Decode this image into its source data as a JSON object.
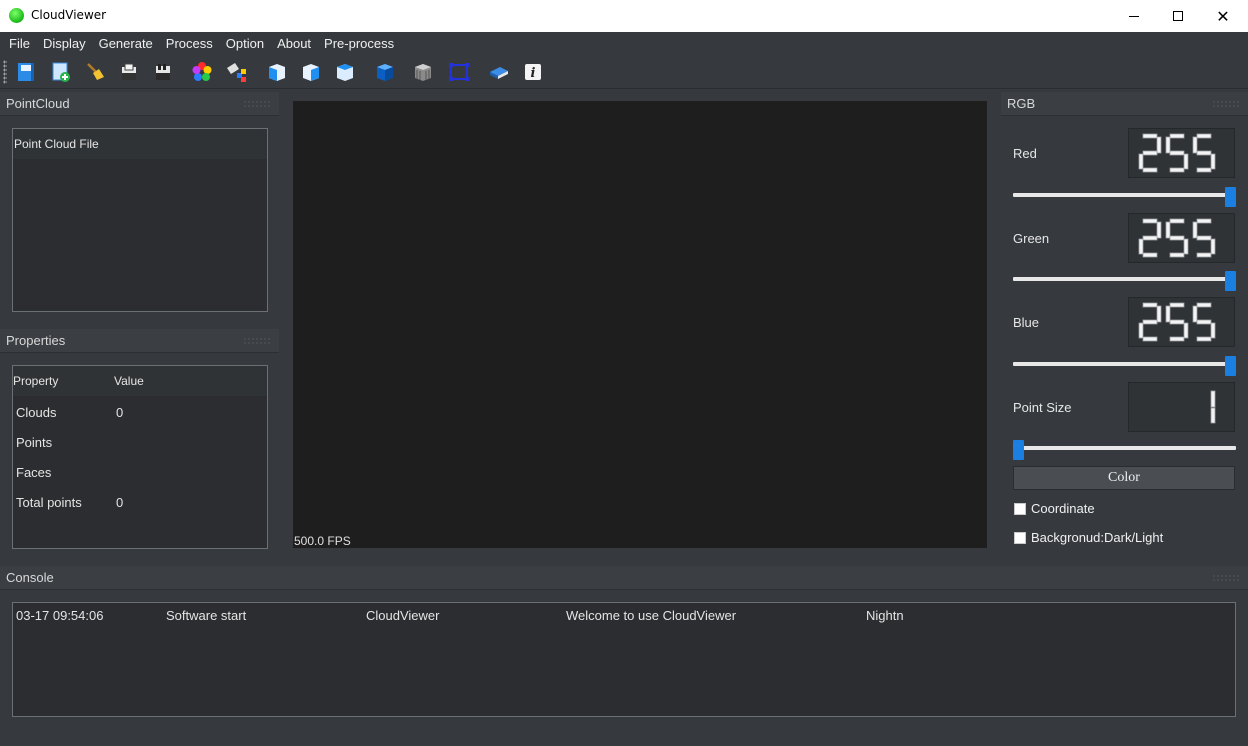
{
  "window": {
    "title": "CloudViewer"
  },
  "menu": [
    "File",
    "Display",
    "Generate",
    "Process",
    "Option",
    "About",
    "Pre-process"
  ],
  "toolbar": {
    "icons": [
      "open-file-icon",
      "add-file-icon",
      "clear-broom-icon",
      "save-icon",
      "save-binary-icon",
      "color-wheel-icon",
      "random-color-icon",
      "view-front-icon",
      "view-top-icon",
      "view-left-icon",
      "view-back-icon",
      "view-bottom-icon",
      "frame-select-icon",
      "book-icon",
      "info-icon"
    ]
  },
  "pointcloud": {
    "title": "PointCloud",
    "header": "Point Cloud File"
  },
  "properties": {
    "title": "Properties",
    "col_property": "Property",
    "col_value": "Value",
    "rows": [
      {
        "name": "Clouds",
        "value": "0"
      },
      {
        "name": "Points",
        "value": ""
      },
      {
        "name": "Faces",
        "value": ""
      },
      {
        "name": "Total points",
        "value": "0"
      }
    ]
  },
  "viewer": {
    "fps": "500.0 FPS"
  },
  "rgb": {
    "title": "RGB",
    "red": {
      "label": "Red",
      "value": "255",
      "level": 1.0
    },
    "green": {
      "label": "Green",
      "value": "255",
      "level": 1.0
    },
    "blue": {
      "label": "Blue",
      "value": "255",
      "level": 1.0
    },
    "point_size": {
      "label": "Point Size",
      "value": "1",
      "level": 0.0
    },
    "color_button": "Color",
    "coordinate": {
      "label": "Coordinate",
      "checked": false
    },
    "background": {
      "label": "Backgronud:Dark/Light",
      "checked": false
    },
    "accent": "#1a7fe0"
  },
  "console": {
    "title": "Console",
    "row": {
      "time": "03-17 09:54:06",
      "operation": "Software start",
      "object": "CloudViewer",
      "details": "Welcome to use CloudViewer",
      "note": "Nightn"
    }
  }
}
